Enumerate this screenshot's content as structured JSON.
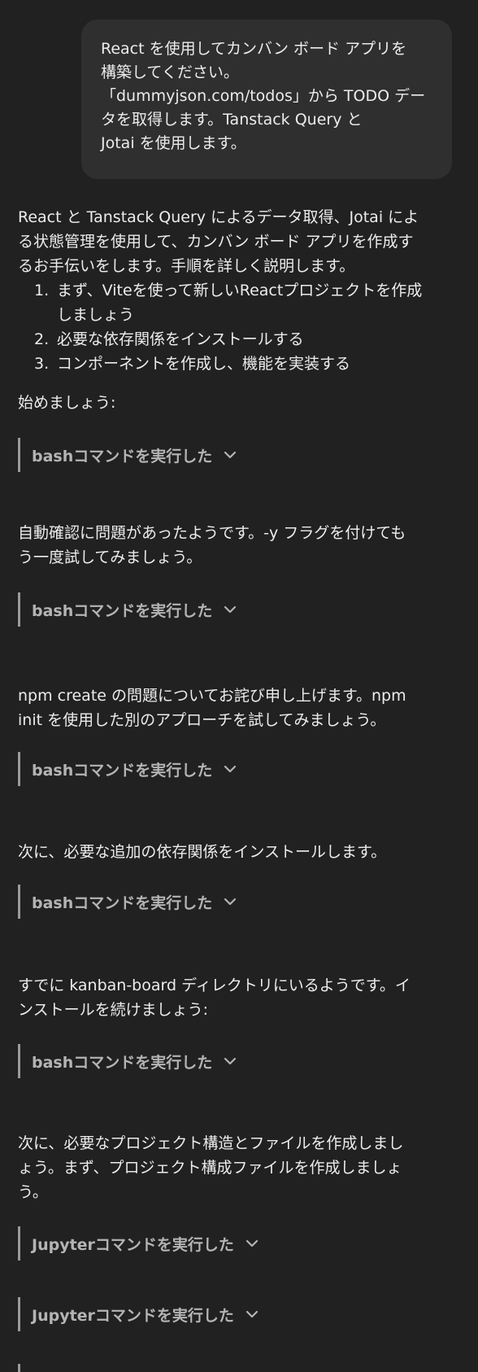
{
  "user_message": {
    "lines": [
      "React を使用してカンバン ボード アプリを",
      "構築してください。",
      "「dummyjson.com/todos」から TODO デー",
      "タを取得します。Tanstack Query と",
      "Jotai を使用します。"
    ]
  },
  "assistant": {
    "intro_lines": [
      "React と Tanstack Query によるデータ取得、Jotai によ",
      "る状態管理を使用して、カンバン ボード アプリを作成す",
      "るお手伝いをします。手順を詳しく説明します。"
    ],
    "steps": [
      {
        "num": "1.",
        "lines": [
          "まず、Viteを使って新しいReactプロジェクトを作成",
          "しましょう"
        ]
      },
      {
        "num": "2.",
        "lines": [
          "必要な依存関係をインストールする"
        ]
      },
      {
        "num": "3.",
        "lines": [
          "コンポーネントを作成し、機能を実装する"
        ]
      }
    ],
    "start_text": "始めましょう:",
    "tool_bash_label": "bashコマンドを実行した",
    "tool_jupyter_label": "Jupyterコマンドを実行した",
    "msg2_lines": [
      "自動確認に問題があったようです。-y フラグを付けても",
      "う一度試してみましょう。"
    ],
    "msg3_lines": [
      "npm create の問題についてお詫び申し上げます。npm",
      "init を使用した別のアプローチを試してみましょう。"
    ],
    "msg4_lines": [
      "次に、必要な追加の依存関係をインストールします。"
    ],
    "msg5_lines": [
      "すでに kanban-board ディレクトリにいるようです。イ",
      "ンストールを続けましょう:"
    ],
    "msg6_lines": [
      "次に、必要なプロジェクト構造とファイルを作成しまし",
      "ょう。まず、プロジェクト構成ファイルを作成しましょ",
      "う。"
    ]
  },
  "icons": {
    "expand": "chevron-down-icon"
  },
  "colors": {
    "background": "#212121",
    "user_bubble": "#2f2f2f",
    "text": "#ececec",
    "tool_label": "#b4b4b4",
    "tool_border": "#9a9a9a"
  }
}
